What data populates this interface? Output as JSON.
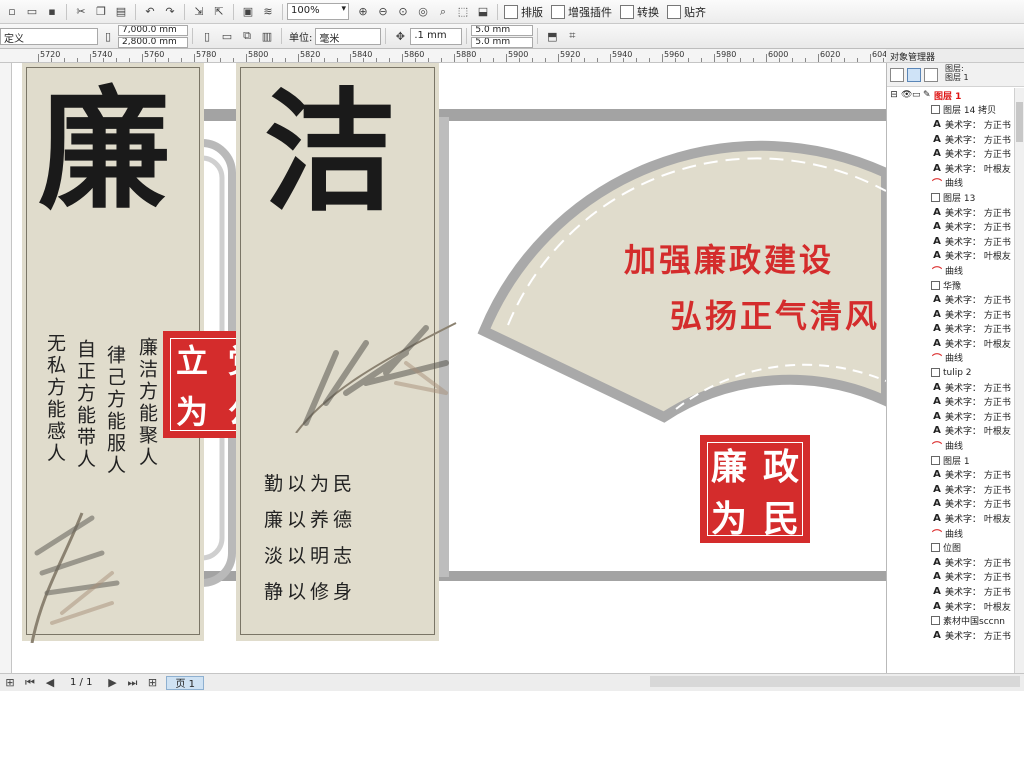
{
  "toolbar": {
    "zoom_value": "100%",
    "btn_arrange": "排版",
    "btn_enhance": "增强插件",
    "btn_convert": "转换",
    "btn_snap": "贴齐"
  },
  "propbar": {
    "doc_label": "定义",
    "width": "7,000.0 mm",
    "height": "2,800.0 mm",
    "unit_label": "单位:",
    "unit_value": "毫米",
    "nudge": ".1 mm",
    "dup_x": "5.0 mm",
    "dup_y": "5.0 mm"
  },
  "ruler": {
    "labels": [
      "5720",
      "5740",
      "5760",
      "5780",
      "5800",
      "5820",
      "5840",
      "5860",
      "5880",
      "5900",
      "5920",
      "5940",
      "5960",
      "5980",
      "6000",
      "6020",
      "6040",
      "6060"
    ]
  },
  "object_manager": {
    "title": "对象管理器",
    "layer_info_1": "图层:",
    "layer_info_2": "图层 1",
    "layer_root": "图层 1",
    "rows": [
      {
        "type": "group",
        "label": "图层 14 拷贝"
      },
      {
        "type": "text",
        "label": "美术字： 方正书"
      },
      {
        "type": "text",
        "label": "美术字： 方正书"
      },
      {
        "type": "text",
        "label": "美术字： 方正书"
      },
      {
        "type": "text",
        "label": "美术字： 叶根友"
      },
      {
        "type": "curve",
        "label": "曲线"
      },
      {
        "type": "group",
        "label": "图层 13"
      },
      {
        "type": "text",
        "label": "美术字： 方正书"
      },
      {
        "type": "text",
        "label": "美术字： 方正书"
      },
      {
        "type": "text",
        "label": "美术字： 方正书"
      },
      {
        "type": "text",
        "label": "美术字： 叶根友"
      },
      {
        "type": "curve",
        "label": "曲线"
      },
      {
        "type": "group",
        "label": "华豫"
      },
      {
        "type": "text",
        "label": "美术字： 方正书"
      },
      {
        "type": "text",
        "label": "美术字： 方正书"
      },
      {
        "type": "text",
        "label": "美术字： 方正书"
      },
      {
        "type": "text",
        "label": "美术字： 叶根友"
      },
      {
        "type": "curve",
        "label": "曲线"
      },
      {
        "type": "group",
        "label": "tulip 2"
      },
      {
        "type": "text",
        "label": "美术字： 方正书"
      },
      {
        "type": "text",
        "label": "美术字： 方正书"
      },
      {
        "type": "text",
        "label": "美术字： 方正书"
      },
      {
        "type": "text",
        "label": "美术字： 叶根友"
      },
      {
        "type": "curve",
        "label": "曲线"
      },
      {
        "type": "group",
        "label": "图层 1"
      },
      {
        "type": "text",
        "label": "美术字： 方正书"
      },
      {
        "type": "text",
        "label": "美术字： 方正书"
      },
      {
        "type": "text",
        "label": "美术字： 方正书"
      },
      {
        "type": "text",
        "label": "美术字： 叶根友"
      },
      {
        "type": "curve",
        "label": "曲线"
      },
      {
        "type": "group",
        "label": "位图"
      },
      {
        "type": "text",
        "label": "美术字： 方正书"
      },
      {
        "type": "text",
        "label": "美术字： 方正书"
      },
      {
        "type": "text",
        "label": "美术字： 方正书"
      },
      {
        "type": "text",
        "label": "美术字： 叶根友"
      },
      {
        "type": "group",
        "label": "素材中国sccnn"
      },
      {
        "type": "text",
        "label": "美术字： 方正书"
      }
    ]
  },
  "artwork": {
    "panel_a_char": "廉",
    "panel_b_char": "洁",
    "panel_a_cols": [
      "廉洁方能聚人",
      "律己方能服人",
      "自正方能带人",
      "无私方能感人"
    ],
    "seal_a": [
      "立",
      "党",
      "为",
      "公"
    ],
    "mottos": [
      "勤以为民",
      "廉以养德",
      "淡以明志",
      "静以修身"
    ],
    "slogan_1": "加强廉政建设",
    "slogan_2": "弘扬正气清风",
    "seal_b": [
      "廉",
      "政",
      "为",
      "民"
    ]
  },
  "status": {
    "page_counter": "1 / 1",
    "page_tab": "页 1"
  },
  "colors": {
    "accent_red": "#d42c2c",
    "panel_beige": "#e0dccc",
    "frame_gray": "#a9a9a9"
  }
}
